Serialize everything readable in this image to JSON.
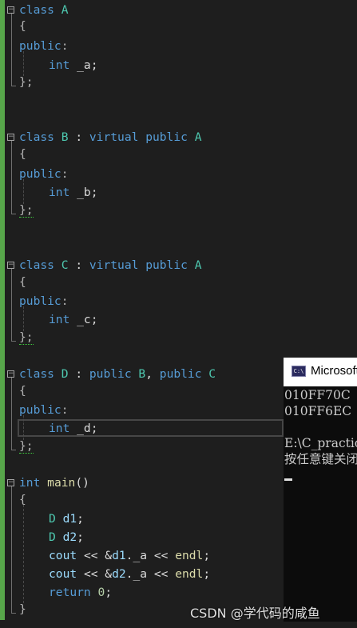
{
  "editor": {
    "lines": [
      [
        {
          "t": "class",
          "c": "kw"
        },
        {
          "t": " ",
          "c": "plain"
        },
        {
          "t": "A",
          "c": "ty"
        }
      ],
      [
        {
          "t": "{",
          "c": "pun"
        }
      ],
      [
        {
          "t": "public",
          "c": "kw"
        },
        {
          "t": ":",
          "c": "pun"
        }
      ],
      [
        {
          "t": "int",
          "c": "kw"
        },
        {
          "t": " _a;",
          "c": "plain"
        }
      ],
      [
        {
          "t": "};",
          "c": "pun"
        }
      ],
      [
        {
          "t": "class",
          "c": "kw"
        },
        {
          "t": " ",
          "c": "plain"
        },
        {
          "t": "B",
          "c": "ty"
        },
        {
          "t": " : ",
          "c": "plain"
        },
        {
          "t": "virtual",
          "c": "kw"
        },
        {
          "t": " ",
          "c": "plain"
        },
        {
          "t": "public",
          "c": "kw"
        },
        {
          "t": " ",
          "c": "plain"
        },
        {
          "t": "A",
          "c": "ty"
        }
      ],
      [
        {
          "t": "{",
          "c": "pun"
        }
      ],
      [
        {
          "t": "public",
          "c": "kw"
        },
        {
          "t": ":",
          "c": "pun"
        }
      ],
      [
        {
          "t": "int",
          "c": "kw"
        },
        {
          "t": " _b;",
          "c": "plain"
        }
      ],
      [
        {
          "t": "};",
          "c": "pun",
          "sq": true
        }
      ],
      [
        {
          "t": "class",
          "c": "kw"
        },
        {
          "t": " ",
          "c": "plain"
        },
        {
          "t": "C",
          "c": "ty"
        },
        {
          "t": " : ",
          "c": "plain"
        },
        {
          "t": "virtual",
          "c": "kw"
        },
        {
          "t": " ",
          "c": "plain"
        },
        {
          "t": "public",
          "c": "kw"
        },
        {
          "t": " ",
          "c": "plain"
        },
        {
          "t": "A",
          "c": "ty"
        }
      ],
      [
        {
          "t": "{",
          "c": "pun"
        }
      ],
      [
        {
          "t": "public",
          "c": "kw"
        },
        {
          "t": ":",
          "c": "pun"
        }
      ],
      [
        {
          "t": "int",
          "c": "kw"
        },
        {
          "t": " _c;",
          "c": "plain"
        }
      ],
      [
        {
          "t": "};",
          "c": "pun",
          "sq": true
        }
      ],
      [
        {
          "t": "class",
          "c": "kw"
        },
        {
          "t": " ",
          "c": "plain"
        },
        {
          "t": "D",
          "c": "ty"
        },
        {
          "t": " : ",
          "c": "plain"
        },
        {
          "t": "public",
          "c": "kw"
        },
        {
          "t": " ",
          "c": "plain"
        },
        {
          "t": "B",
          "c": "ty"
        },
        {
          "t": ", ",
          "c": "plain"
        },
        {
          "t": "public",
          "c": "kw"
        },
        {
          "t": " ",
          "c": "plain"
        },
        {
          "t": "C",
          "c": "ty"
        }
      ],
      [
        {
          "t": "{",
          "c": "pun"
        }
      ],
      [
        {
          "t": "public",
          "c": "kw"
        },
        {
          "t": ":",
          "c": "pun"
        }
      ],
      [
        {
          "t": "int",
          "c": "kw"
        },
        {
          "t": " _d;",
          "c": "plain"
        }
      ],
      [
        {
          "t": "};",
          "c": "pun",
          "sq": true
        }
      ],
      [
        {
          "t": "int",
          "c": "kw"
        },
        {
          "t": " ",
          "c": "plain"
        },
        {
          "t": "main",
          "c": "fn"
        },
        {
          "t": "()",
          "c": "plain"
        }
      ],
      [
        {
          "t": "{",
          "c": "pun"
        }
      ],
      [
        {
          "t": "D",
          "c": "ty"
        },
        {
          "t": " ",
          "c": "plain"
        },
        {
          "t": "d1",
          "c": "var"
        },
        {
          "t": ";",
          "c": "plain"
        }
      ],
      [
        {
          "t": "D",
          "c": "ty"
        },
        {
          "t": " ",
          "c": "plain"
        },
        {
          "t": "d2",
          "c": "var"
        },
        {
          "t": ";",
          "c": "plain"
        }
      ],
      [
        {
          "t": "cout",
          "c": "var"
        },
        {
          "t": " << &",
          "c": "plain"
        },
        {
          "t": "d1",
          "c": "var"
        },
        {
          "t": "._a << ",
          "c": "plain"
        },
        {
          "t": "endl",
          "c": "fn"
        },
        {
          "t": ";",
          "c": "plain"
        }
      ],
      [
        {
          "t": "cout",
          "c": "var"
        },
        {
          "t": " << &",
          "c": "plain"
        },
        {
          "t": "d2",
          "c": "var"
        },
        {
          "t": "._a << ",
          "c": "plain"
        },
        {
          "t": "endl",
          "c": "fn"
        },
        {
          "t": ";",
          "c": "plain"
        }
      ],
      [
        {
          "t": "return",
          "c": "kw"
        },
        {
          "t": " ",
          "c": "plain"
        },
        {
          "t": "0",
          "c": "num"
        },
        {
          "t": ";",
          "c": "plain"
        }
      ],
      [
        {
          "t": "}",
          "c": "pun"
        }
      ]
    ]
  },
  "console": {
    "title": "Microsoft Visual Studio Debug Console",
    "icon_text": "C:\\",
    "lines": [
      "010FF70C",
      "010FF6EC",
      "",
      "E:\\C_practice",
      "按任意键关闭此窗口. . ."
    ]
  },
  "watermark": "CSDN @学代码的咸鱼",
  "colors": {
    "background": "#1e1e1e",
    "keyword": "#569cd6",
    "type": "#4ec9b0",
    "function": "#dcdcaa",
    "variable": "#9cdcfe",
    "number": "#b5cea8",
    "changed_bar": "#57a64a",
    "console_bg": "#0c0c0c"
  }
}
